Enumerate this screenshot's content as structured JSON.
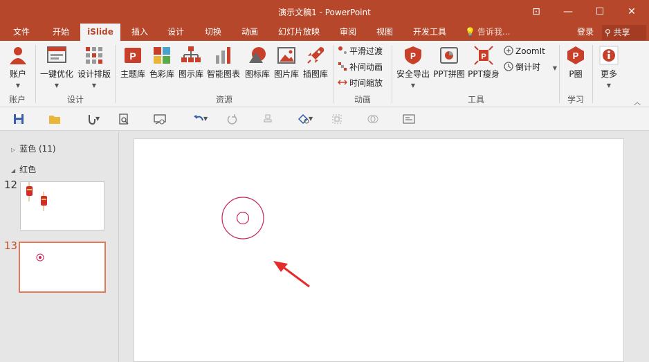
{
  "window": {
    "title": "演示文稿1 - PowerPoint",
    "controls": {
      "ribbon_display": "⊡",
      "minimize": "—",
      "maximize": "☐",
      "close": "✕"
    }
  },
  "tabs": [
    {
      "label": "文件"
    },
    {
      "label": "开始"
    },
    {
      "label": "iSlide",
      "active": true
    },
    {
      "label": "插入"
    },
    {
      "label": "设计"
    },
    {
      "label": "切换"
    },
    {
      "label": "动画"
    },
    {
      "label": "幻灯片放映"
    },
    {
      "label": "审阅"
    },
    {
      "label": "视图"
    },
    {
      "label": "开发工具"
    }
  ],
  "tell_me": {
    "placeholder": "告诉我..."
  },
  "account": {
    "login": "登录",
    "share": "共享"
  },
  "ribbon": {
    "account_group": {
      "button": "账户",
      "label": "账户"
    },
    "design_group": {
      "buttons": [
        "一键优化",
        "设计排版"
      ],
      "label": "设计"
    },
    "resources_group": {
      "buttons": [
        "主题库",
        "色彩库",
        "图示库",
        "智能图表",
        "图标库",
        "图片库",
        "插图库"
      ],
      "label": "资源"
    },
    "animation_group": {
      "buttons": [
        "平滑过渡",
        "补间动画",
        "时间缩放"
      ],
      "label": "动画"
    },
    "tools_group": {
      "buttons": [
        "安全导出",
        "PPT拼图",
        "PPT瘦身"
      ],
      "small": [
        "ZoomIt",
        "倒计时"
      ],
      "label": "工具"
    },
    "learn_group": {
      "button": "P圈",
      "label": "学习"
    },
    "more": {
      "button": "更多"
    },
    "accent": "#b7472a"
  },
  "slides_pane": {
    "sections": [
      {
        "name": "蓝色 (11)",
        "collapsed": true
      },
      {
        "name": "红色",
        "collapsed": false
      }
    ],
    "thumbnails": [
      {
        "number": "12",
        "selected": false
      },
      {
        "number": "13",
        "selected": true
      }
    ]
  },
  "slide_canvas": {
    "shapes": [
      "ring-shape",
      "arrow-annotation"
    ],
    "ring_color": "#c8245d",
    "arrow_color": "#e62b2b"
  }
}
